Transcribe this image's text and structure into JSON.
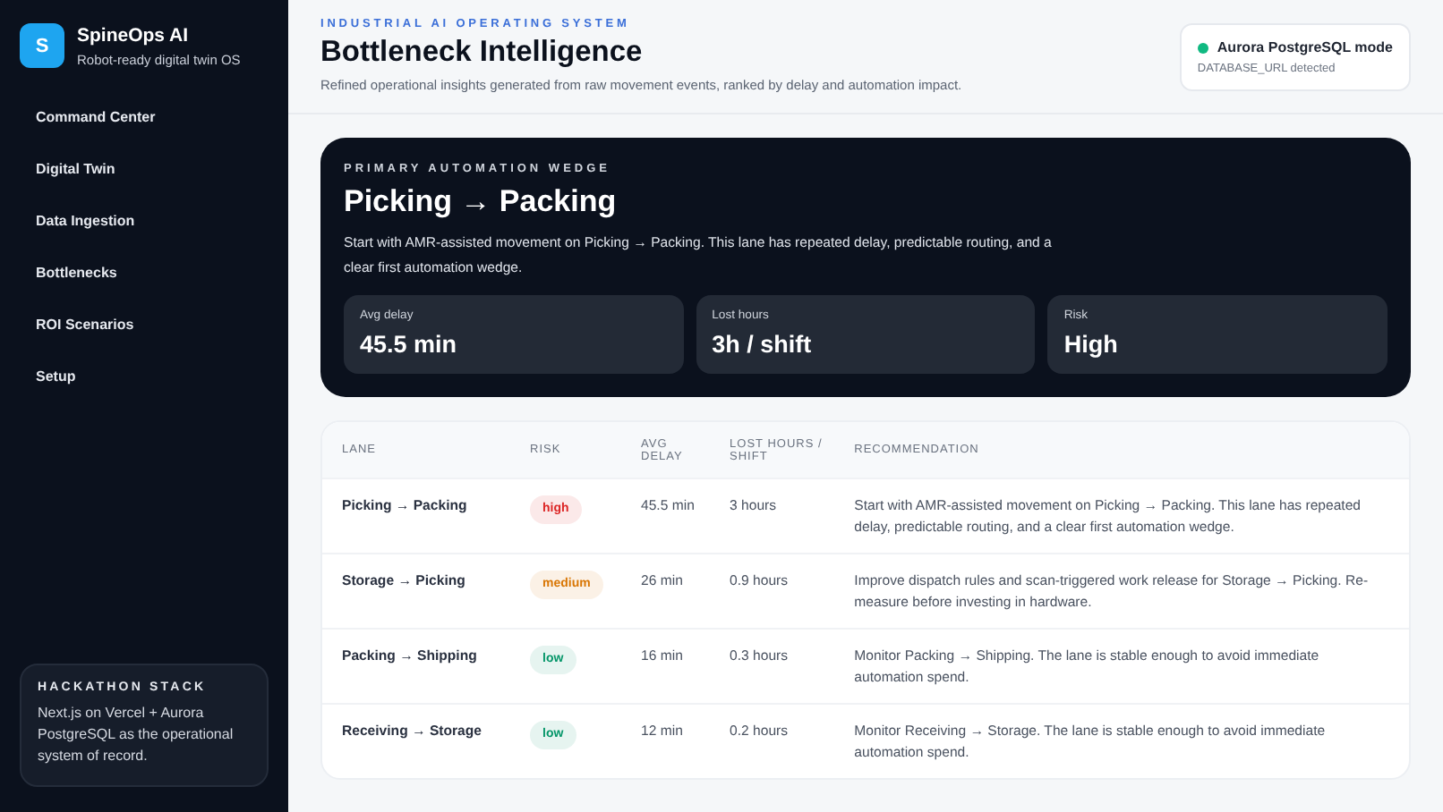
{
  "brand": {
    "logo": "S",
    "name": "SpineOps AI",
    "tagline": "Robot-ready digital twin OS"
  },
  "nav": [
    "Command Center",
    "Digital Twin",
    "Data Ingestion",
    "Bottlenecks",
    "ROI Scenarios",
    "Setup"
  ],
  "stack_card": {
    "title": "HACKATHON STACK",
    "text": "Next.js on Vercel + Aurora PostgreSQL as the operational system of record."
  },
  "header": {
    "eyebrow": "INDUSTRIAL AI OPERATING SYSTEM",
    "title": "Bottleneck Intelligence",
    "subtitle": "Refined operational insights generated from raw movement events, ranked by delay and automation impact."
  },
  "db_status": {
    "title": "Aurora PostgreSQL mode",
    "detail": "DATABASE_URL detected",
    "color": "#10b981"
  },
  "hero": {
    "eyebrow": "PRIMARY AUTOMATION WEDGE",
    "title": "Picking → Packing",
    "text": "Start with AMR-assisted movement on Picking → Packing. This lane has repeated delay, predictable routing, and a clear first automation wedge.",
    "stats": [
      {
        "label": "Avg delay",
        "value": "45.5 min"
      },
      {
        "label": "Lost hours",
        "value": "3h / shift"
      },
      {
        "label": "Risk",
        "value": "High"
      }
    ]
  },
  "table": {
    "columns": [
      "LANE",
      "RISK",
      "AVG DELAY",
      "LOST HOURS / SHIFT",
      "RECOMMENDATION"
    ],
    "rows": [
      {
        "lane": "Picking → Packing",
        "risk": {
          "label": "high",
          "color": "#dc2626"
        },
        "avg_delay": "45.5 min",
        "lost_hours": "3 hours",
        "recommendation": "Start with AMR-assisted movement on Picking → Packing. This lane has repeated delay, predictable routing, and a clear first automation wedge."
      },
      {
        "lane": "Storage → Picking",
        "risk": {
          "label": "medium",
          "color": "#d97706"
        },
        "avg_delay": "26 min",
        "lost_hours": "0.9 hours",
        "recommendation": "Improve dispatch rules and scan-triggered work release for Storage → Picking. Re-measure before investing in hardware."
      },
      {
        "lane": "Packing → Shipping",
        "risk": {
          "label": "low",
          "color": "#059669"
        },
        "avg_delay": "16 min",
        "lost_hours": "0.3 hours",
        "recommendation": "Monitor Packing → Shipping. The lane is stable enough to avoid immediate automation spend."
      },
      {
        "lane": "Receiving → Storage",
        "risk": {
          "label": "low",
          "color": "#059669"
        },
        "avg_delay": "12 min",
        "lost_hours": "0.2 hours",
        "recommendation": "Monitor Receiving → Storage. The lane is stable enough to avoid immediate automation spend."
      }
    ]
  }
}
